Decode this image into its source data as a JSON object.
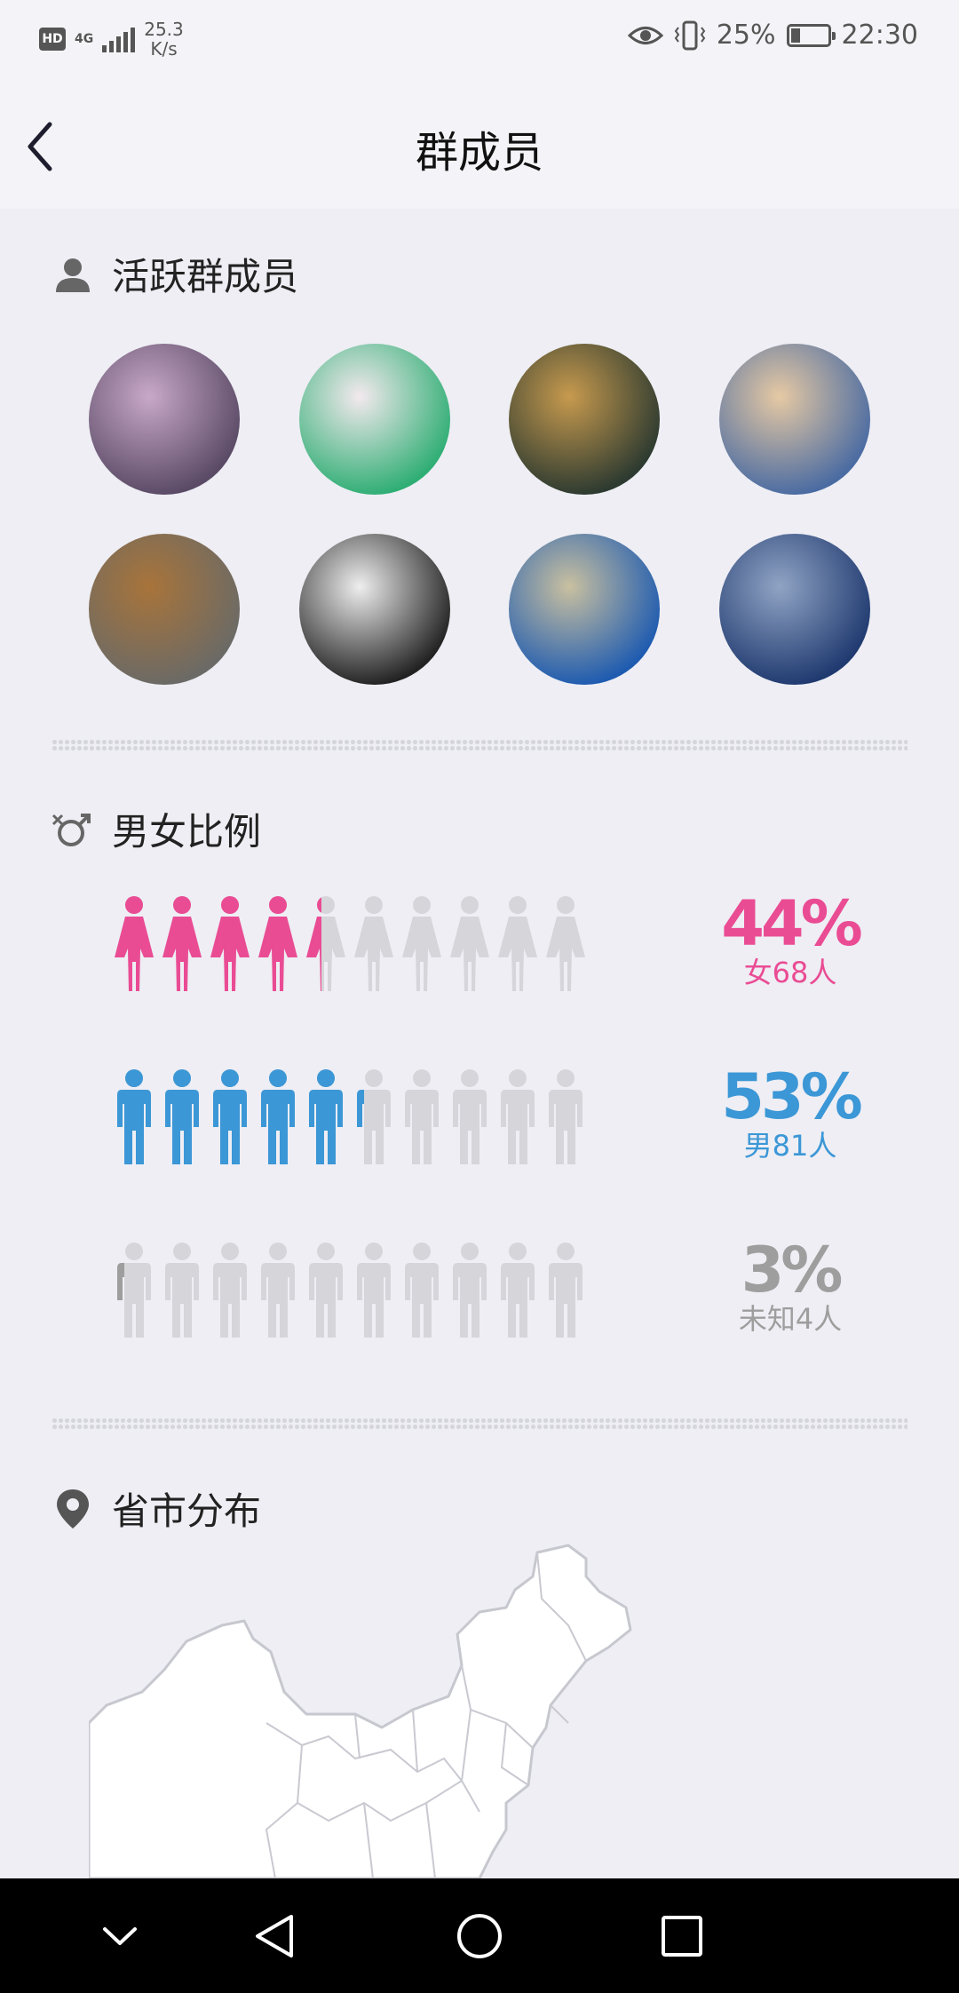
{
  "status_bar": {
    "hd": "HD",
    "network": "4G",
    "speed_value": "25.3",
    "speed_unit": "K/s",
    "battery_percent": "25%",
    "time": "22:30"
  },
  "header": {
    "title": "群成员",
    "back_icon": "chevron-left-icon"
  },
  "active_members": {
    "title": "活跃群成员",
    "icon": "person-icon",
    "avatars": [
      {
        "label": "member avatar 1",
        "colors": [
          "#5a4a66",
          "#c8a8c8"
        ]
      },
      {
        "label": "member avatar 2",
        "colors": [
          "#2fae74",
          "#f3e9ee"
        ]
      },
      {
        "label": "member avatar 3",
        "colors": [
          "#2c3a30",
          "#c79a4e"
        ]
      },
      {
        "label": "member avatar 4",
        "colors": [
          "#4a6ba2",
          "#e6c9a3"
        ]
      },
      {
        "label": "member avatar 5",
        "colors": [
          "#6b6a66",
          "#a8743a"
        ]
      },
      {
        "label": "member avatar 6",
        "colors": [
          "#222222",
          "#eeeeee"
        ]
      },
      {
        "label": "member avatar 7",
        "colors": [
          "#1e5bb0",
          "#c9c0a0"
        ]
      },
      {
        "label": "member avatar 8",
        "colors": [
          "#203a70",
          "#90a4c4"
        ]
      }
    ]
  },
  "gender_ratio": {
    "title": "男女比例",
    "icon": "gender-icon",
    "rows": [
      {
        "kind": "female",
        "percent": "44%",
        "count": "女68人",
        "color": "#ea4c94",
        "fill_fraction": 0.44
      },
      {
        "kind": "male",
        "percent": "53%",
        "count": "男81人",
        "color": "#3c97d6",
        "fill_fraction": 0.53
      },
      {
        "kind": "unknown",
        "percent": "3%",
        "count": "未知4人",
        "color": "#9e9e9e",
        "fill_fraction": 0.03
      }
    ]
  },
  "province": {
    "title": "省市分布",
    "icon": "location-pin-icon",
    "map_icon": "china-map-icon"
  },
  "bottom_nav": {
    "buttons": [
      "chevron-down-icon",
      "back-triangle-icon",
      "home-circle-icon",
      "recents-square-icon"
    ]
  }
}
